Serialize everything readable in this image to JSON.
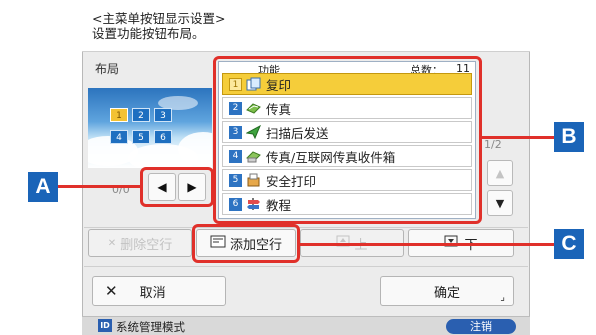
{
  "header": {
    "title": "<主菜单按钮显示设置>",
    "subtitle": "设置功能按钮布局。"
  },
  "layout": {
    "label": "布局",
    "slots": [
      "1",
      "2",
      "3",
      "4",
      "5",
      "6"
    ],
    "page_indicator": "0/0"
  },
  "list": {
    "column_label": "功能",
    "total_label": "总数：",
    "total": "11",
    "page_indicator": "1/2",
    "rows": [
      {
        "num": "1",
        "label": "复印"
      },
      {
        "num": "2",
        "label": "传真"
      },
      {
        "num": "3",
        "label": "扫描后发送"
      },
      {
        "num": "4",
        "label": "传真/互联网传真收件箱"
      },
      {
        "num": "5",
        "label": "安全打印"
      },
      {
        "num": "6",
        "label": "教程"
      }
    ]
  },
  "actions": {
    "delete_blank": "删除空行",
    "add_blank": "添加空行",
    "up": "上",
    "down": "下"
  },
  "footer_buttons": {
    "cancel": "取消",
    "ok": "确定"
  },
  "footer": {
    "mode": "系统管理模式",
    "logout": "注销"
  },
  "callouts": {
    "a": "A",
    "b": "B",
    "c": "C"
  },
  "colors": {
    "accent_red": "#e0302a",
    "callout_blue": "#1a64b8",
    "selected_row": "#f5cd3a"
  }
}
